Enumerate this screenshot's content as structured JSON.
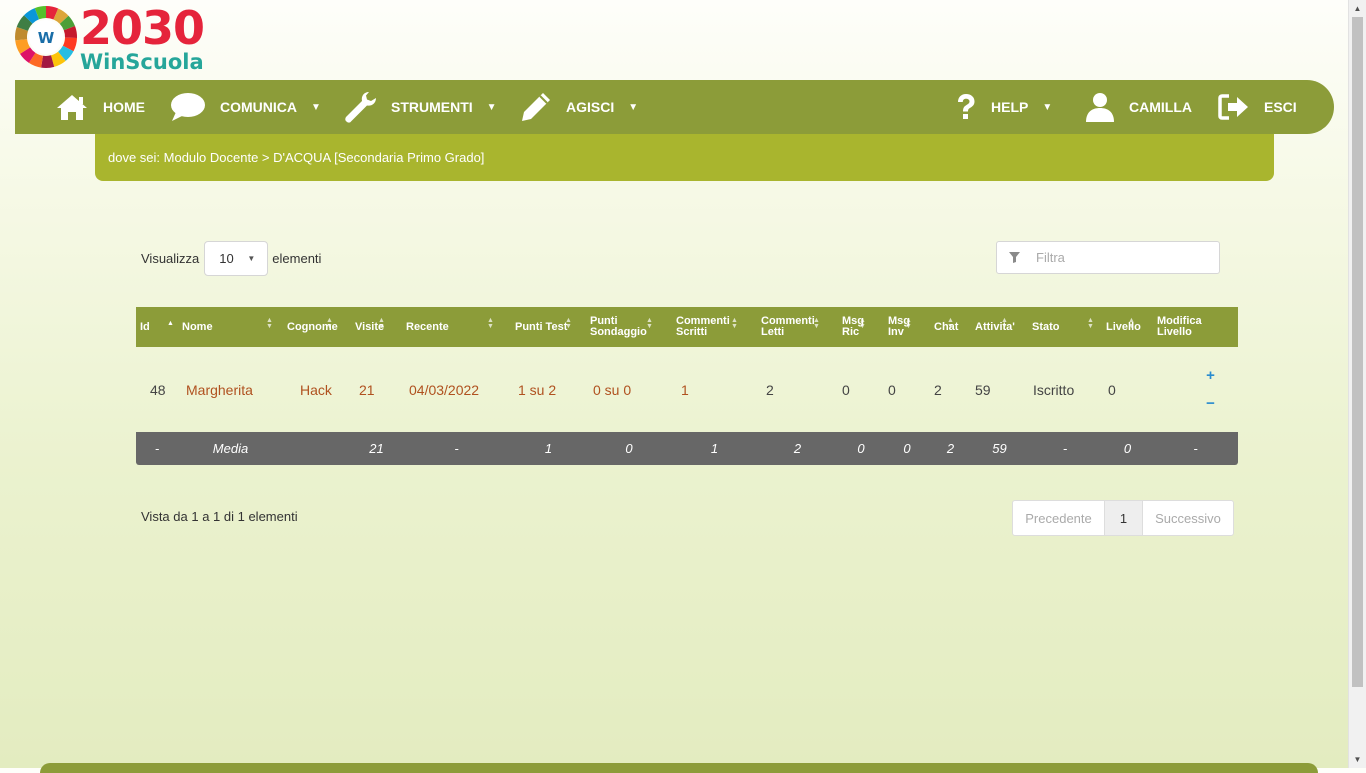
{
  "logo": {
    "number": "2030",
    "brand": "WinScuola",
    "badge": "W"
  },
  "nav": {
    "home": "HOME",
    "comunica": "COMUNICA",
    "strumenti": "STRUMENTI",
    "agisci": "AGISCI",
    "help": "HELP",
    "user": "CAMILLA",
    "exit": "ESCI"
  },
  "breadcrumb": "dove sei: Modulo Docente > D'ACQUA [Secondaria Primo Grado]",
  "length_menu": {
    "before": "Visualizza",
    "value": "10",
    "after": "elementi"
  },
  "filter": {
    "placeholder": "Filtra"
  },
  "table": {
    "headers": [
      "Id",
      "Nome",
      "Cognome",
      "Visite",
      "Recente",
      "Punti Test",
      "Punti Sondaggio",
      "Commenti Scritti",
      "Commenti Letti",
      "Msg Ric",
      "Msg Inv",
      "Chat",
      "Attivita'",
      "Stato",
      "Livello",
      "Modifica Livello"
    ],
    "header_lines": [
      [
        "Id"
      ],
      [
        "Nome"
      ],
      [
        "Cognome"
      ],
      [
        "Visite"
      ],
      [
        "Recente"
      ],
      [
        "Punti Test"
      ],
      [
        "Punti",
        "Sondaggio"
      ],
      [
        "Commenti",
        "Scritti"
      ],
      [
        "Commenti",
        "Letti"
      ],
      [
        "Msg",
        "Ric"
      ],
      [
        "Msg",
        "Inv"
      ],
      [
        "Chat"
      ],
      [
        "Attivita'"
      ],
      [
        "Stato"
      ],
      [
        "Livello"
      ],
      [
        "Modifica",
        "Livello"
      ]
    ],
    "rows": [
      {
        "id": "48",
        "nome": "Margherita",
        "cognome": "Hack",
        "visite": "21",
        "recente": "04/03/2022",
        "punti_test": "1 su 2",
        "punti_sondaggio": "0 su 0",
        "commenti_scritti": "1",
        "commenti_letti": "2",
        "msg_ric": "0",
        "msg_inv": "0",
        "chat": "2",
        "attivita": "59",
        "stato": "Iscritto",
        "livello": "0",
        "plus": "+",
        "minus": "−"
      }
    ],
    "footer": [
      "-",
      "Media",
      "21",
      "-",
      "1",
      "0",
      "1",
      "2",
      "0",
      "0",
      "2",
      "59",
      "-",
      "0",
      "-"
    ]
  },
  "info": "Vista da 1 a 1 di 1 elementi",
  "pagination": {
    "prev": "Precedente",
    "current": "1",
    "next": "Successivo"
  },
  "colors": {
    "nav": "#8c9c39",
    "breadcrumb": "#a9b52e",
    "link": "#b0511f",
    "footer_row": "#676767",
    "level_buttons": "#2a8ccf"
  },
  "icons": [
    "home-icon",
    "chat-bubble-icon",
    "wrench-icon",
    "pencil-icon",
    "question-icon",
    "user-icon",
    "logout-icon",
    "filter-icon",
    "sdg-wheel-icon"
  ]
}
